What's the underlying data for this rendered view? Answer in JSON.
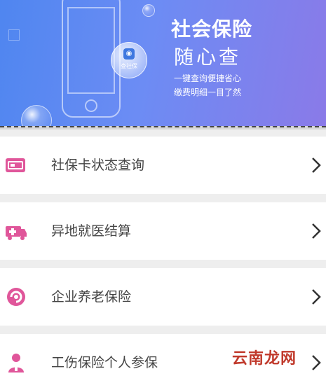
{
  "banner": {
    "title": "社会保险",
    "subtitle": "随心查",
    "line1": "一键查询便捷省心",
    "line2": "缴费明细一目了然",
    "badge_label": "查社保"
  },
  "menu": [
    {
      "label": "社保卡状态查询",
      "icon": "card-icon"
    },
    {
      "label": "异地就医结算",
      "icon": "ambulance-icon"
    },
    {
      "label": "企业养老保险",
      "icon": "pension-icon"
    },
    {
      "label": "工伤保险个人参保",
      "icon": "worker-icon"
    }
  ],
  "watermark": "云南龙网",
  "colors": {
    "accent": "#e0569a",
    "banner_start": "#4f86f0",
    "banner_end": "#8a7ae8"
  }
}
